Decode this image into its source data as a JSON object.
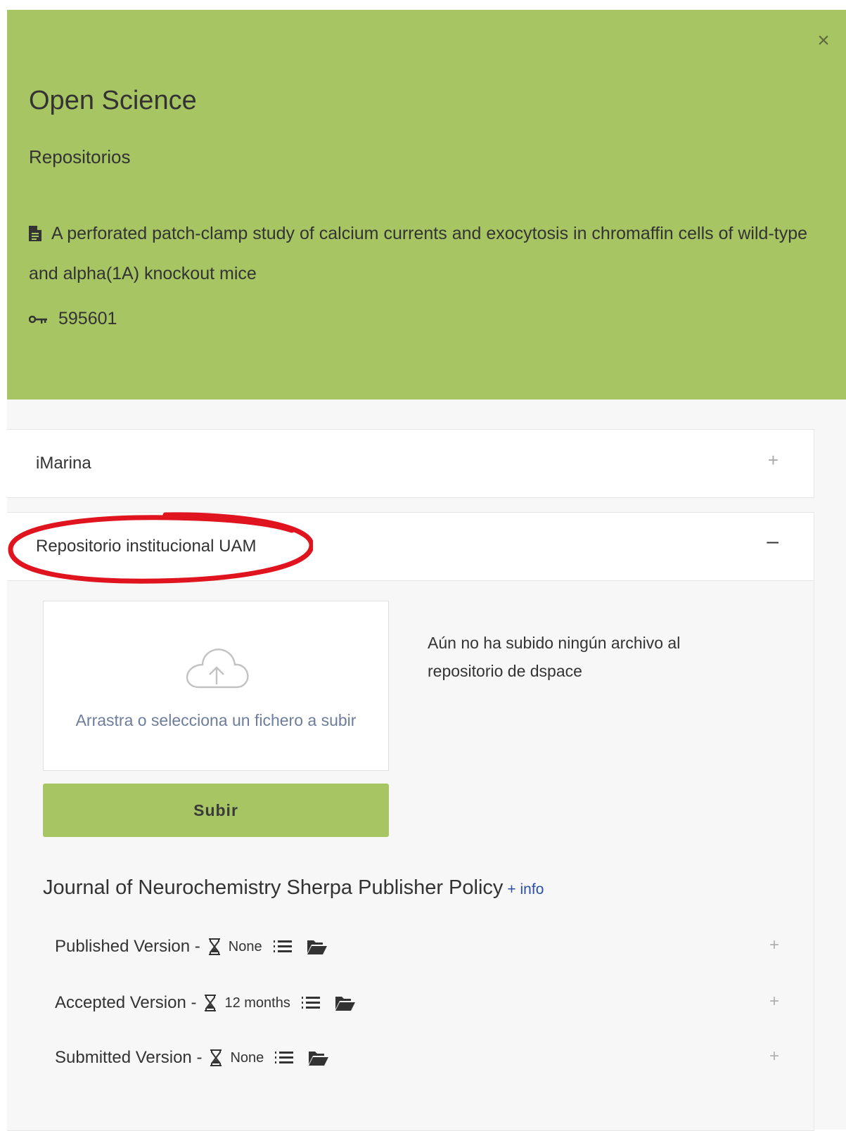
{
  "header": {
    "close_symbol": "×",
    "title": "Open Science",
    "subtitle": "Repositorios",
    "publication_title": "A perforated patch-clamp study of calcium currents and exocytosis in chromaffin cells of wild-type and alpha(1A) knockout mice",
    "publication_id": "595601",
    "background_color": "#a7c563"
  },
  "panels": [
    {
      "label": "iMarina",
      "toggle": "+"
    },
    {
      "label": "Repositorio institucional UAM",
      "toggle": "–"
    }
  ],
  "upload": {
    "dropzone_text": "Arrastra o selecciona un fichero a subir",
    "button_label": "Subir",
    "notice": "Aún no ha subido ningún archivo al repositorio de dspace"
  },
  "policy": {
    "title": "Journal of Neurochemistry Sherpa Publisher Policy",
    "info_link": "+ info",
    "versions": [
      {
        "label": "Published Version -",
        "embargo": "None",
        "toggle": "+"
      },
      {
        "label": "Accepted Version -",
        "embargo": "12 months",
        "toggle": "+"
      },
      {
        "label": "Submitted Version -",
        "embargo": "None",
        "toggle": "+"
      }
    ]
  },
  "annotation_color": "#e0141e"
}
